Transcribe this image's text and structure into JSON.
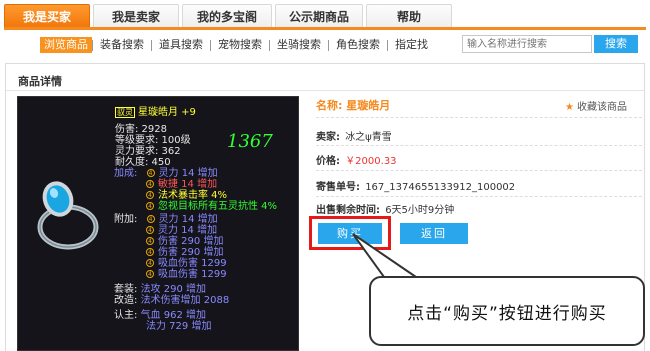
{
  "tabs": [
    {
      "label": "我是买家",
      "active": true
    },
    {
      "label": "我是卖家",
      "active": false
    },
    {
      "label": "我的多宝阁",
      "active": false
    },
    {
      "label": "公示期商品",
      "active": false
    },
    {
      "label": "帮助",
      "active": false
    }
  ],
  "subnav": [
    "浏览商品",
    "装备搜索",
    "道具搜索",
    "宠物搜索",
    "坐骑搜索",
    "角色搜索",
    "指定找"
  ],
  "search": {
    "placeholder": "输入名称进行搜索",
    "button": "搜索"
  },
  "panel_title": "商品详情",
  "item_card": {
    "badge": "驭灵",
    "name": "星璇皓月 +9",
    "score": "1367",
    "stats": [
      "伤害: 2928",
      "等级要求: 100级",
      "灵力要求: 362",
      "耐久度: 450"
    ],
    "plus_label": "加成:",
    "plus": [
      {
        "text": "灵力 14 增加",
        "color": "b"
      },
      {
        "text": "敏捷 14 增加",
        "color": "r"
      },
      {
        "text": "法术暴击率 4%",
        "color": "y"
      },
      {
        "text": "忽视目标所有五灵抗性 4%",
        "color": "g"
      }
    ],
    "attach_label": "附加:",
    "attach": [
      "灵力 14 增加",
      "灵力 14 增加",
      "伤害 290 增加",
      "伤害 290 增加",
      "吸血伤害 1299",
      "吸血伤害 1299"
    ],
    "set_label": "套装:",
    "set_value": "法攻 290 增加",
    "refine_label": "改造:",
    "refine_value": "法术伤害增加 2088",
    "cert_label": "认主:",
    "cert_values": [
      "气血 962 增加",
      "法力 729 增加"
    ]
  },
  "detail": {
    "name_label": "名称:",
    "name_value": "星璇皓月",
    "favorite": "收藏该商品",
    "seller_label": "卖家:",
    "seller_value": "冰之ψ青雪",
    "price_label": "价格:",
    "price_value": "￥2000.33",
    "order_label": "寄售单号:",
    "order_value": "167_1374655133912_100002",
    "time_label": "出售剩余时间:",
    "time_value": "6天5小时9分钟",
    "buy_button": "购买",
    "back_button": "返回"
  },
  "callout": "点击“购买”按钮进行购买",
  "colors": {
    "accent": "#f58a1e",
    "button": "#29a6ec",
    "highlight": "#e61919",
    "price": "#e33333"
  }
}
